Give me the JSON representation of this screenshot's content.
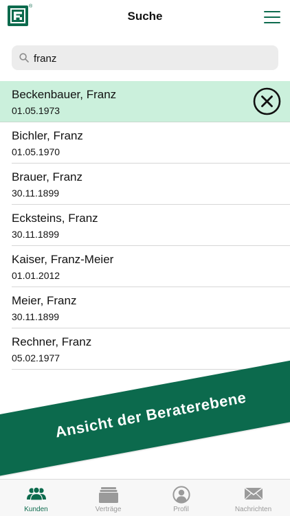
{
  "header": {
    "title": "Suche",
    "logo_mark": "®",
    "brand_color": "#0c6a4d"
  },
  "search": {
    "value": "franz",
    "icon": "search-icon"
  },
  "results": [
    {
      "name": "Beckenbauer, Franz",
      "date": "01.05.1973",
      "selected": true
    },
    {
      "name": "Bichler, Franz",
      "date": "01.05.1970"
    },
    {
      "name": "Brauer, Franz",
      "date": "30.11.1899"
    },
    {
      "name": "Ecksteins, Franz",
      "date": "30.11.1899"
    },
    {
      "name": "Kaiser, Franz-Meier",
      "date": "01.01.2012"
    },
    {
      "name": "Meier, Franz",
      "date": "30.11.1899"
    },
    {
      "name": "Rechner, Franz",
      "date": "05.02.1977"
    }
  ],
  "banner": {
    "text": "Ansicht der Beraterebene"
  },
  "tabs": [
    {
      "label": "Kunden",
      "icon": "customers-icon",
      "active": true
    },
    {
      "label": "Verträge",
      "icon": "contracts-icon"
    },
    {
      "label": "Profil",
      "icon": "profile-icon"
    },
    {
      "label": "Nachrichten",
      "icon": "messages-icon"
    }
  ],
  "colors": {
    "accent": "#0c6a4d",
    "selected_row": "#cbf0dc",
    "inactive_tab": "#9a9a9a"
  }
}
